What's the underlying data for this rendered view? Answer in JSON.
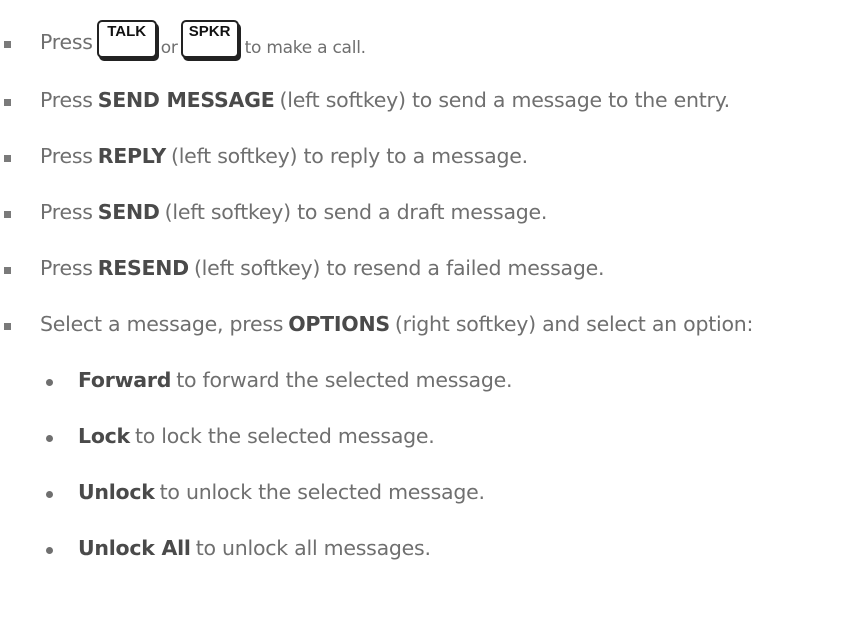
{
  "items": [
    {
      "level": 1,
      "pre": "Press",
      "key1": "TALK",
      "mid": "or",
      "key2": "SPKR",
      "post": "to make a call."
    },
    {
      "level": 1,
      "pre": "Press",
      "bold": "SEND MESSAGE",
      "post": "(left softkey) to send a message to the entry."
    },
    {
      "level": 1,
      "pre": "Press",
      "bold": "REPLY",
      "post": "(left softkey) to reply to a message."
    },
    {
      "level": 1,
      "pre": "Press",
      "bold": "SEND",
      "post": "(left softkey) to send a draft message."
    },
    {
      "level": 1,
      "pre": "Press",
      "bold": "RESEND",
      "post": "(left softkey) to resend a failed message."
    },
    {
      "level": 1,
      "pre": "Select a message, press",
      "bold": "OPTIONS",
      "post": "(right softkey) and select an option:"
    },
    {
      "level": 2,
      "bold": "Forward",
      "post": "to forward the selected message."
    },
    {
      "level": 2,
      "bold": "Lock",
      "post": "to lock the selected message."
    },
    {
      "level": 2,
      "bold": "Unlock",
      "post": "to unlock the selected message."
    },
    {
      "level": 2,
      "bold": "Unlock All",
      "post": "to unlock all messages."
    }
  ]
}
